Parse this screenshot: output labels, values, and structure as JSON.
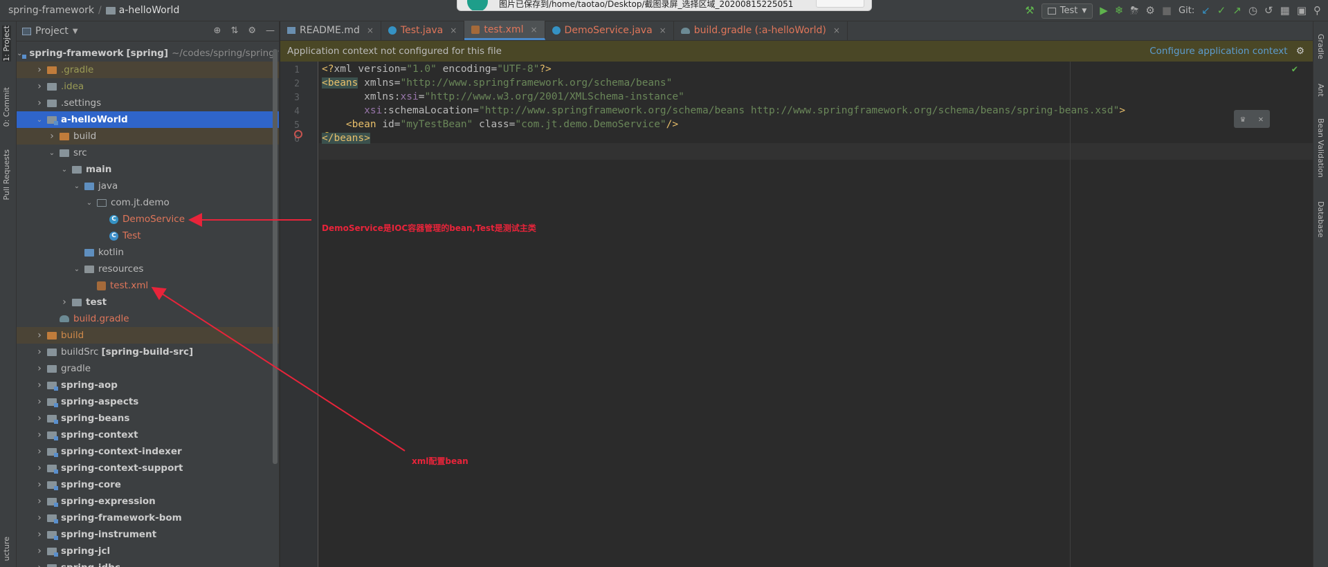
{
  "navbar": {
    "breadcrumb_root": "spring-framework",
    "breadcrumb_module": "a-helloWorld",
    "toast_text": "图片已保存到/home/taotao/Desktop/截图录屏_选择区域_20200815225051",
    "run_config": "Test",
    "git_label": "Git:"
  },
  "left_stripe": {
    "tabs": [
      "1: Project",
      "0: Commit",
      "Pull Requests",
      "ucture"
    ]
  },
  "right_stripe": {
    "tabs": [
      "Gradle",
      "Ant",
      "Bean Validation",
      "Database"
    ]
  },
  "project_panel": {
    "title": "Project",
    "tree": [
      {
        "label": "spring-framework",
        "extra": "[spring]",
        "path": "~/codes/spring/spring-framework",
        "depth": 0,
        "expanded": true,
        "icon": "module-folder-icon",
        "style": "bold"
      },
      {
        "label": ".gradle",
        "depth": 1,
        "expanded": false,
        "icon": "excluded-folder-icon",
        "style": "olive",
        "highlight": true
      },
      {
        "label": ".idea",
        "depth": 1,
        "expanded": false,
        "icon": "folder-icon",
        "style": "olive"
      },
      {
        "label": ".settings",
        "depth": 1,
        "expanded": false,
        "icon": "folder-icon",
        "style": "normal"
      },
      {
        "label": "a-helloWorld",
        "depth": 1,
        "expanded": true,
        "icon": "module-folder-icon",
        "style": "bold",
        "selected": true
      },
      {
        "label": "build",
        "depth": 2,
        "expanded": false,
        "icon": "excluded-folder-icon",
        "style": "normal",
        "highlight": true
      },
      {
        "label": "src",
        "depth": 2,
        "expanded": true,
        "icon": "folder-icon",
        "style": "normal"
      },
      {
        "label": "main",
        "depth": 3,
        "expanded": true,
        "icon": "folder-icon",
        "style": "bold"
      },
      {
        "label": "java",
        "depth": 4,
        "expanded": true,
        "icon": "source-folder-icon",
        "style": "normal"
      },
      {
        "label": "com.jt.demo",
        "depth": 5,
        "expanded": true,
        "icon": "package-icon",
        "style": "normal"
      },
      {
        "label": "DemoService",
        "depth": 6,
        "icon": "class-icon",
        "style": "red"
      },
      {
        "label": "Test",
        "depth": 6,
        "icon": "test-class-icon",
        "style": "red"
      },
      {
        "label": "kotlin",
        "depth": 4,
        "icon": "source-folder-icon",
        "style": "normal"
      },
      {
        "label": "resources",
        "depth": 4,
        "expanded": true,
        "icon": "resources-folder-icon",
        "style": "normal"
      },
      {
        "label": "test.xml",
        "depth": 5,
        "icon": "xml-file-icon",
        "style": "red"
      },
      {
        "label": "test",
        "depth": 3,
        "expanded": false,
        "icon": "folder-icon",
        "style": "bold"
      },
      {
        "label": "build.gradle",
        "depth": 2,
        "icon": "gradle-file-icon",
        "style": "red"
      },
      {
        "label": "build",
        "depth": 1,
        "expanded": false,
        "icon": "excluded-folder-icon",
        "style": "orange",
        "highlight": true
      },
      {
        "label": "buildSrc",
        "extra": "[spring-build-src]",
        "depth": 1,
        "expanded": false,
        "icon": "folder-icon",
        "style": "normal"
      },
      {
        "label": "gradle",
        "depth": 1,
        "expanded": false,
        "icon": "folder-icon",
        "style": "normal"
      },
      {
        "label": "spring-aop",
        "depth": 1,
        "expanded": false,
        "icon": "module-folder-icon",
        "style": "bold"
      },
      {
        "label": "spring-aspects",
        "depth": 1,
        "expanded": false,
        "icon": "module-folder-icon",
        "style": "bold"
      },
      {
        "label": "spring-beans",
        "depth": 1,
        "expanded": false,
        "icon": "module-folder-icon",
        "style": "bold"
      },
      {
        "label": "spring-context",
        "depth": 1,
        "expanded": false,
        "icon": "module-folder-icon",
        "style": "bold"
      },
      {
        "label": "spring-context-indexer",
        "depth": 1,
        "expanded": false,
        "icon": "module-folder-icon",
        "style": "bold"
      },
      {
        "label": "spring-context-support",
        "depth": 1,
        "expanded": false,
        "icon": "module-folder-icon",
        "style": "bold"
      },
      {
        "label": "spring-core",
        "depth": 1,
        "expanded": false,
        "icon": "module-folder-icon",
        "style": "bold"
      },
      {
        "label": "spring-expression",
        "depth": 1,
        "expanded": false,
        "icon": "module-folder-icon",
        "style": "bold"
      },
      {
        "label": "spring-framework-bom",
        "depth": 1,
        "expanded": false,
        "icon": "module-folder-icon",
        "style": "bold"
      },
      {
        "label": "spring-instrument",
        "depth": 1,
        "expanded": false,
        "icon": "module-folder-icon",
        "style": "bold"
      },
      {
        "label": "spring-jcl",
        "depth": 1,
        "expanded": false,
        "icon": "module-folder-icon",
        "style": "bold"
      },
      {
        "label": "spring-jdbc",
        "depth": 1,
        "expanded": false,
        "icon": "module-folder-icon",
        "style": "bold"
      }
    ]
  },
  "editor": {
    "tabs": [
      {
        "label": "README.md",
        "icon": "markdown-icon",
        "active": false
      },
      {
        "label": "Test.java",
        "icon": "test-class-icon",
        "active": false,
        "red": true
      },
      {
        "label": "test.xml",
        "icon": "xml-file-icon",
        "active": true,
        "red": true
      },
      {
        "label": "DemoService.java",
        "icon": "class-icon",
        "active": false,
        "red": true
      },
      {
        "label": "build.gradle (:a-helloWorld)",
        "icon": "gradle-file-icon",
        "active": false,
        "red": true
      }
    ],
    "banner_text": "Application context not configured for this file",
    "banner_link": "Configure application context",
    "line_numbers": [
      "1",
      "2",
      "3",
      "4",
      "5",
      "6"
    ]
  },
  "annotations": {
    "demo_note": "DemoService是IOC容器管理的bean,Test是测试主类",
    "xml_note": "xml配置bean"
  },
  "colors": {
    "selection": "#2f65ca",
    "annotation": "#e8243a",
    "banner_bg": "#4a4726"
  }
}
